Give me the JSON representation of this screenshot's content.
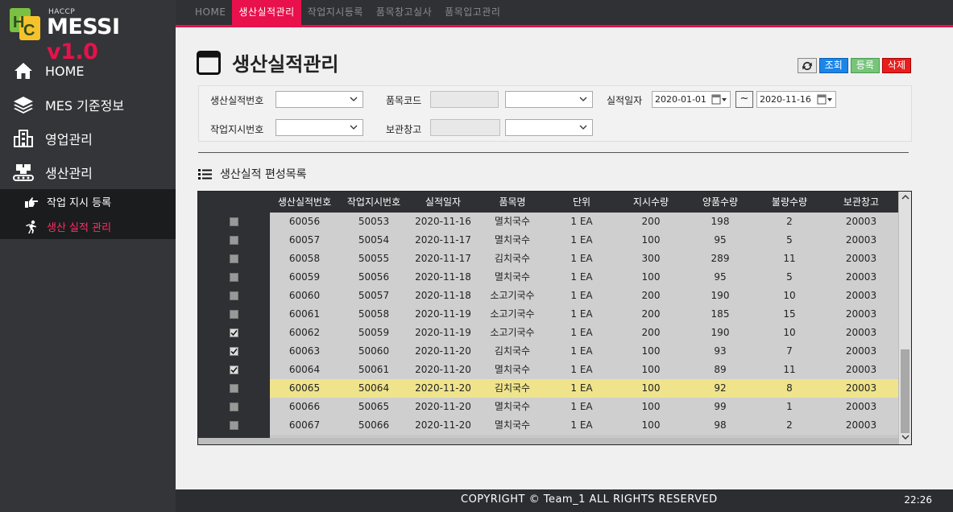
{
  "logo": {
    "haccp": "HACCP",
    "name": "MESSI ",
    "version": "v1.0",
    "badge": "HC"
  },
  "sidebar": {
    "items": [
      {
        "label": "HOME",
        "icon": "home-icon"
      },
      {
        "label": "MES 기준정보",
        "icon": "layers-icon"
      },
      {
        "label": "영업관리",
        "icon": "building-icon"
      },
      {
        "label": "생산관리",
        "icon": "factory-icon"
      }
    ],
    "sub": [
      {
        "label": "작업 지시 등록",
        "icon": "pointing-hand-icon"
      },
      {
        "label": "생산 실적 관리",
        "icon": "runner-icon"
      }
    ]
  },
  "tabs": [
    "HOME",
    "생산실적관리",
    "작업지시등록",
    "품목창고실사",
    "품목입고관리"
  ],
  "page": {
    "title": "생산실적관리"
  },
  "actions": {
    "search": "조회",
    "register": "등록",
    "delete": "삭제"
  },
  "filter": {
    "production_no_label": "생산실적번호",
    "item_code_label": "품목코드",
    "result_date_label": "실적일자",
    "date_from": "2020-01-01",
    "date_to": "2020-11-16",
    "tilde": "~",
    "work_order_label": "작업지시번호",
    "warehouse_label": "보관창고"
  },
  "section": {
    "title": "생산실적 편성목록"
  },
  "grid": {
    "columns": [
      "생산실적번호",
      "작업지시번호",
      "실적일자",
      "품목명",
      "단위",
      "지시수량",
      "양품수량",
      "불량수량",
      "보관창고"
    ],
    "rows": [
      {
        "checked": false,
        "highlight": false,
        "cells": [
          "60056",
          "50053",
          "2020-11-16",
          "멸치국수",
          "1 EA",
          "200",
          "198",
          "2",
          "20003"
        ]
      },
      {
        "checked": false,
        "highlight": false,
        "cells": [
          "60057",
          "50054",
          "2020-11-17",
          "멸치국수",
          "1 EA",
          "100",
          "95",
          "5",
          "20003"
        ]
      },
      {
        "checked": false,
        "highlight": false,
        "cells": [
          "60058",
          "50055",
          "2020-11-17",
          "김치국수",
          "1 EA",
          "300",
          "289",
          "11",
          "20003"
        ]
      },
      {
        "checked": false,
        "highlight": false,
        "cells": [
          "60059",
          "50056",
          "2020-11-18",
          "멸치국수",
          "1 EA",
          "100",
          "95",
          "5",
          "20003"
        ]
      },
      {
        "checked": false,
        "highlight": false,
        "cells": [
          "60060",
          "50057",
          "2020-11-18",
          "소고기국수",
          "1 EA",
          "200",
          "190",
          "10",
          "20003"
        ]
      },
      {
        "checked": false,
        "highlight": false,
        "cells": [
          "60061",
          "50058",
          "2020-11-19",
          "소고기국수",
          "1 EA",
          "200",
          "185",
          "15",
          "20003"
        ]
      },
      {
        "checked": true,
        "highlight": false,
        "cells": [
          "60062",
          "50059",
          "2020-11-19",
          "소고기국수",
          "1 EA",
          "200",
          "190",
          "10",
          "20003"
        ]
      },
      {
        "checked": true,
        "highlight": false,
        "cells": [
          "60063",
          "50060",
          "2020-11-20",
          "김치국수",
          "1 EA",
          "100",
          "93",
          "7",
          "20003"
        ]
      },
      {
        "checked": true,
        "highlight": false,
        "cells": [
          "60064",
          "50061",
          "2020-11-20",
          "멸치국수",
          "1 EA",
          "100",
          "89",
          "11",
          "20003"
        ]
      },
      {
        "checked": false,
        "highlight": true,
        "cells": [
          "60065",
          "50064",
          "2020-11-20",
          "김치국수",
          "1 EA",
          "100",
          "92",
          "8",
          "20003"
        ]
      },
      {
        "checked": false,
        "highlight": false,
        "cells": [
          "60066",
          "50065",
          "2020-11-20",
          "멸치국수",
          "1 EA",
          "100",
          "99",
          "1",
          "20003"
        ]
      },
      {
        "checked": false,
        "highlight": false,
        "cells": [
          "60067",
          "50066",
          "2020-11-20",
          "멸치국수",
          "1 EA",
          "100",
          "98",
          "2",
          "20003"
        ]
      }
    ]
  },
  "footer": {
    "copyright": "COPYRIGHT © Team_1 ALL RIGHTS RESERVED",
    "clock": "22:26"
  },
  "colors": {
    "accent": "#e8114b",
    "sidebar": "#333538",
    "highlight_row": "#efe48c"
  }
}
